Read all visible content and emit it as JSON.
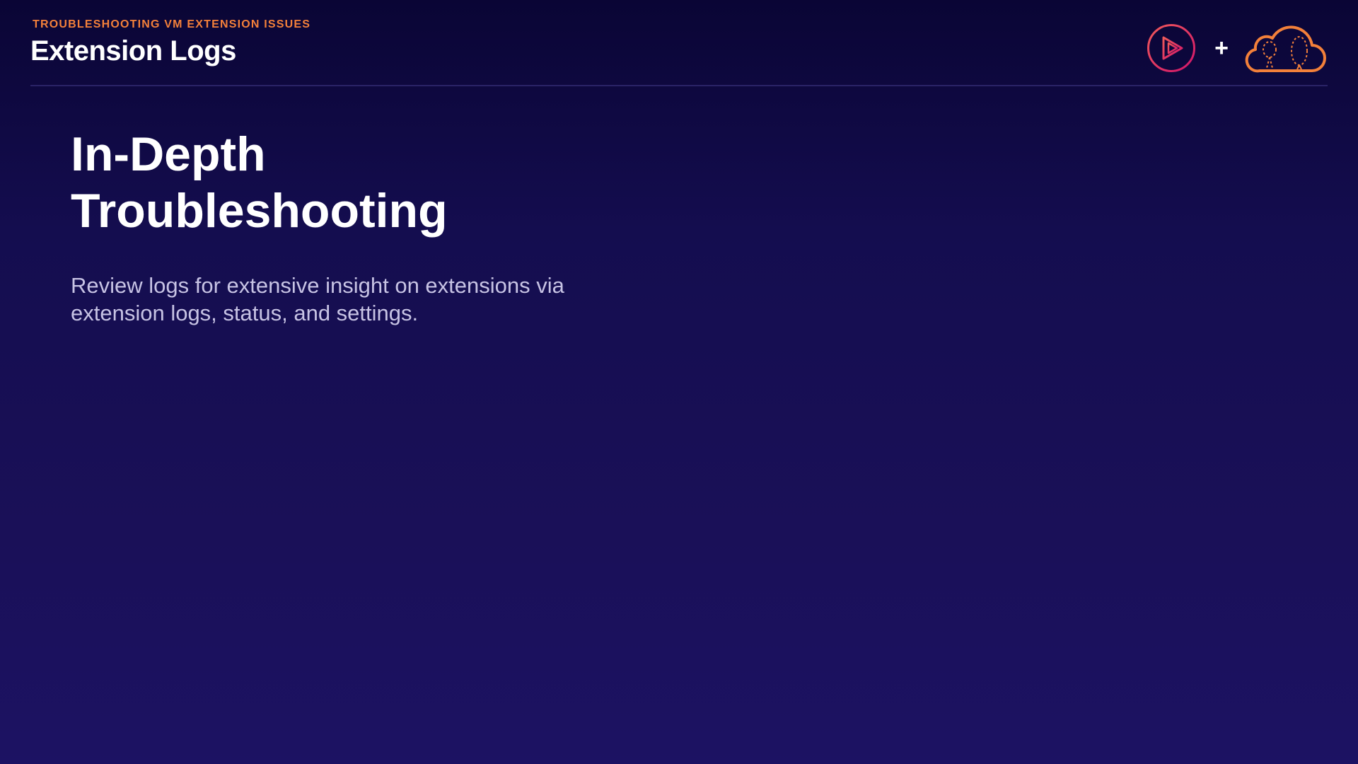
{
  "header": {
    "eyebrow": "TROUBLESHOOTING VM EXTENSION ISSUES",
    "title": "Extension Logs",
    "plus": "+"
  },
  "logos": {
    "play_logo": "pluralsight-play-icon",
    "cloud_logo": "cloud-academy-icon"
  },
  "main": {
    "heading_line1": "In-Depth",
    "heading_line2": "Troubleshooting",
    "body": "Review logs for extensive insight on extensions via extension logs, status, and settings."
  },
  "colors": {
    "accent_orange": "#f3803a",
    "accent_pink": "#e8245e",
    "background": "#140d4f",
    "text_primary": "#ffffff",
    "text_secondary": "#c7c3e4"
  }
}
